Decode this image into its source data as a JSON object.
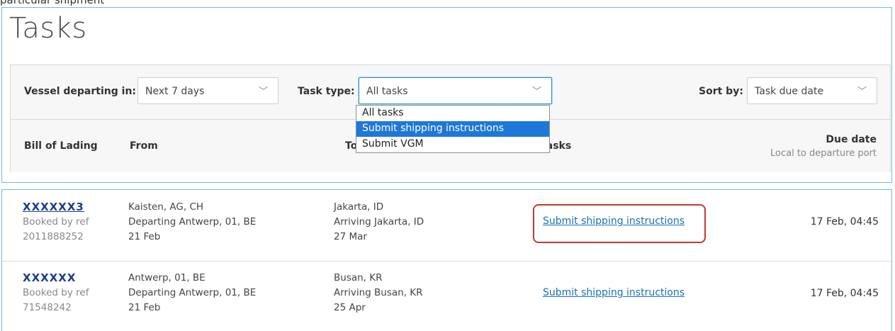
{
  "caption": "particular shipment",
  "page": {
    "title": "Tasks"
  },
  "filters": {
    "vessel_label": "Vessel departing in:",
    "vessel_value": "Next 7 days",
    "task_type_label": "Task type:",
    "task_type_value": "All tasks",
    "sort_label": "Sort by:",
    "sort_value": "Task due date"
  },
  "dropdown": {
    "options": [
      "All tasks",
      "Submit shipping instructions",
      "Submit VGM"
    ],
    "highlighted": "Submit shipping instructions"
  },
  "columns": {
    "bol": "Bill of Lading",
    "from": "From",
    "to": "To",
    "tasks": "Tasks",
    "due": "Due date",
    "due_sub": "Local to departure port"
  },
  "rows": [
    {
      "bol": "XXXXXX3",
      "booked_label": "Booked by ref",
      "booked_ref": "2011888252",
      "from_place": "Kaisten, AG, CH",
      "from_departing": "Departing Antwerp, 01, BE",
      "from_date": "21 Feb",
      "to_place": "Jakarta, ID",
      "to_arriving": "Arriving Jakarta, ID",
      "to_date": "27 Mar",
      "task": "Submit shipping instructions",
      "due": "17 Feb, 04:45"
    },
    {
      "bol": "XXXXXX",
      "booked_label": "Booked by ref",
      "booked_ref": "71548242",
      "from_place": "Antwerp, 01, BE",
      "from_departing": "Departing Antwerp, 01, BE",
      "from_date": "21 Feb",
      "to_place": "Busan, KR",
      "to_arriving": "Arriving Busan, KR",
      "to_date": "25 Apr",
      "task": "Submit shipping instructions",
      "due": "17 Feb, 04:45"
    }
  ],
  "colors": {
    "panel_border": "#79b6e2",
    "link": "#1d6fb8",
    "highlight_box": "#c8372d",
    "dropdown_selected": "#1e78d7"
  }
}
